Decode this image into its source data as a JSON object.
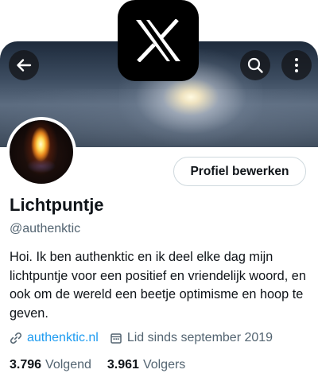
{
  "profile": {
    "name": "Lichtpuntje",
    "handle": "@authenktic",
    "bio": "Hoi. Ik ben authenktic en ik deel elke dag mijn lichtpuntje voor een positief en vriendelijk woord, en ook om de wereld een beetje optimisme en hoop te geven.",
    "website": "authenktic.nl",
    "joined": "Lid sinds september 2019",
    "edit_label": "Profiel bewerken"
  },
  "stats": {
    "following_count": "3.796",
    "following_label": "Volgend",
    "followers_count": "3.961",
    "followers_label": "Volgers"
  },
  "icons": {
    "app_logo": "x-logo-icon",
    "back": "arrow-left-icon",
    "search": "search-icon",
    "more": "more-vertical-icon",
    "link": "link-icon",
    "calendar": "calendar-icon"
  },
  "colors": {
    "accent": "#1d9bf0",
    "secondary_text": "#536471",
    "primary_text": "#0f1419",
    "border": "#cfd9de"
  }
}
